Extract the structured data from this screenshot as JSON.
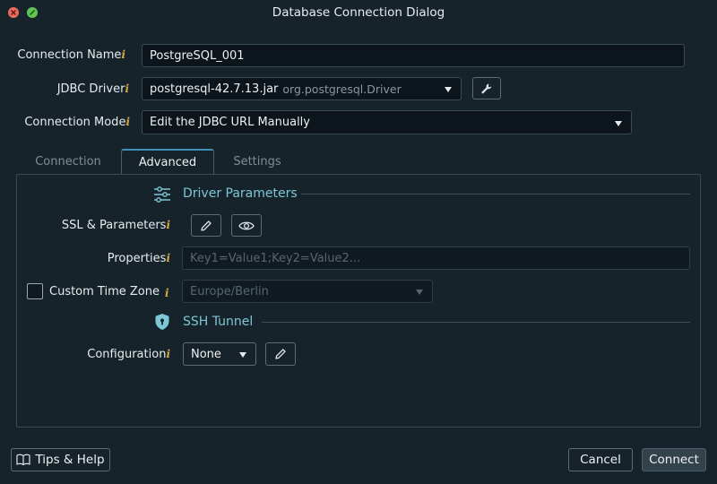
{
  "window": {
    "title": "Database Connection Dialog"
  },
  "form": {
    "connection_name_label": "Connection Name",
    "connection_name_value": "PostgreSQL_001",
    "jdbc_driver_label": "JDBC Driver",
    "jdbc_driver_value": "postgresql-42.7.13.jar",
    "jdbc_driver_class": "org.postgresql.Driver",
    "connection_mode_label": "Connection Mode",
    "connection_mode_value": "Edit the JDBC URL Manually",
    "info_glyph": "i"
  },
  "tabs": [
    {
      "label": "Connection",
      "active": false
    },
    {
      "label": "Advanced",
      "active": true
    },
    {
      "label": "Settings",
      "active": false
    }
  ],
  "advanced": {
    "driver_section_title": "Driver Parameters",
    "ssl_label": "SSL & Parameters",
    "properties_label": "Properties",
    "properties_placeholder": "Key1=Value1;Key2=Value2...",
    "custom_tz_label": "Custom Time Zone",
    "custom_tz_checked": false,
    "custom_tz_value": "Europe/Berlin",
    "ssh_section_title": "SSH Tunnel",
    "configuration_label": "Configuration",
    "configuration_value": "None"
  },
  "footer": {
    "help_label": "Tips & Help",
    "cancel_label": "Cancel",
    "connect_label": "Connect"
  },
  "colors": {
    "background": "#16232b",
    "accent": "#7ec7d6",
    "info": "#d9a640",
    "close": "#ed6a5e",
    "maximize": "#61c554"
  }
}
